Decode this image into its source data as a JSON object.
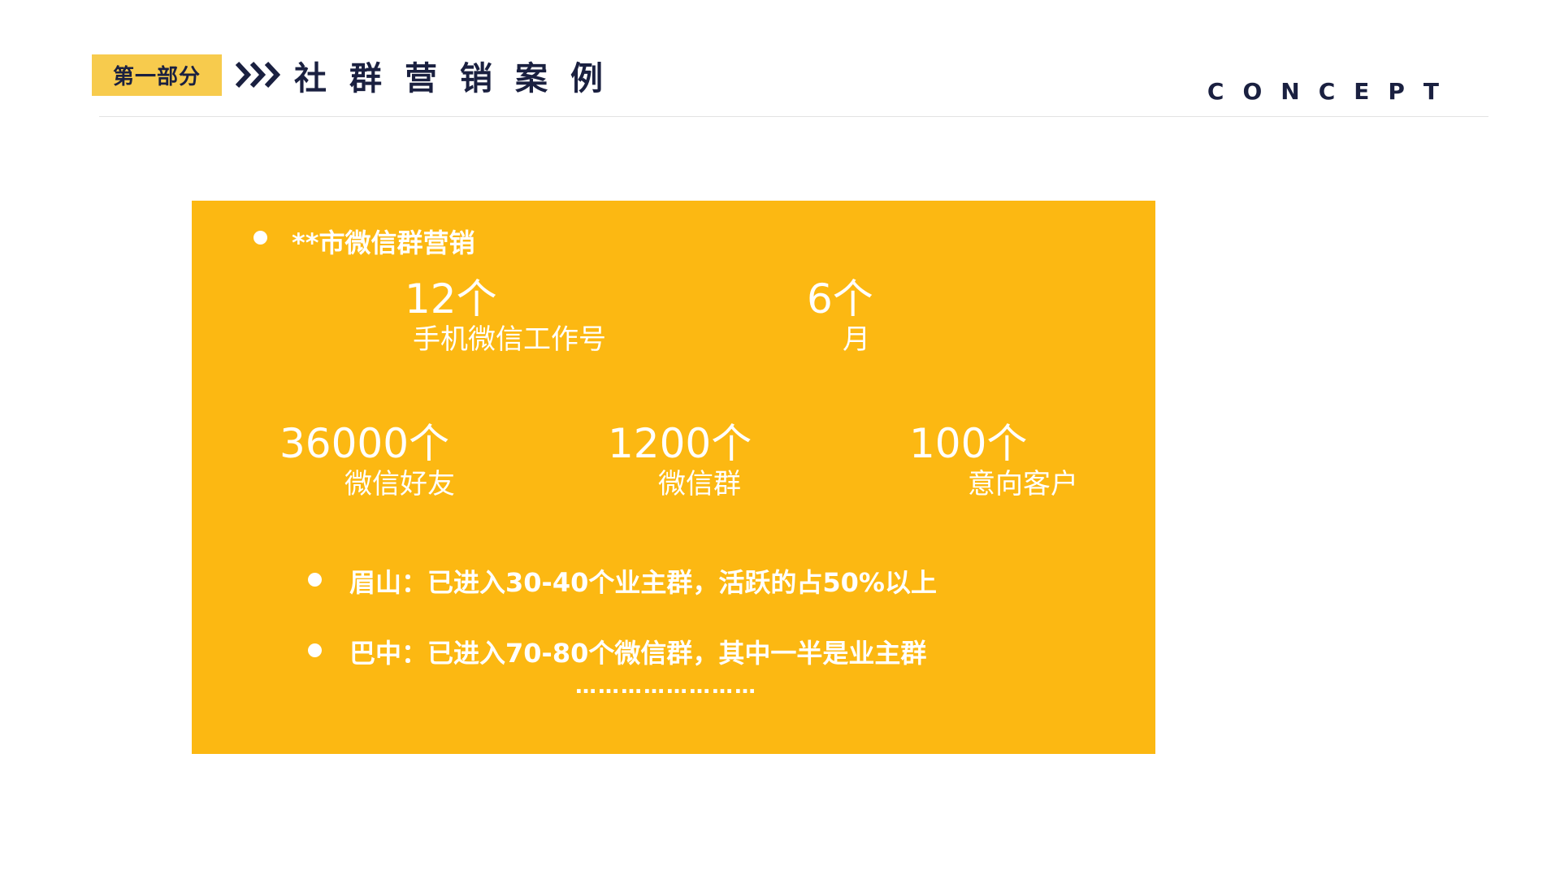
{
  "header": {
    "section_badge": "第一部分",
    "chevrons_icon": "triple-chevron-right-icon",
    "section_title": "社群营销案例",
    "concept_label": "CONCEPT"
  },
  "colors": {
    "navy": "#1a2040",
    "badge_yellow": "#f7cb4d",
    "panel_orange_yellow": "#fcb812",
    "text_on_panel": "#ffffff"
  },
  "panel": {
    "heading": "**市微信群营销",
    "stats_row1": [
      {
        "number": "12个",
        "label": "手机微信工作号"
      },
      {
        "number": "6个",
        "label": "月"
      }
    ],
    "stats_row2": [
      {
        "number": "36000个",
        "label": "微信好友"
      },
      {
        "number": "1200个",
        "label": "微信群"
      },
      {
        "number": "100个",
        "label": "意向客户"
      }
    ],
    "notes": [
      "眉山：已进入30-40个业主群，活跃的占50%以上",
      "巴中：已进入70-80个微信群，其中一半是业主群"
    ],
    "ellipsis": "……………………"
  }
}
